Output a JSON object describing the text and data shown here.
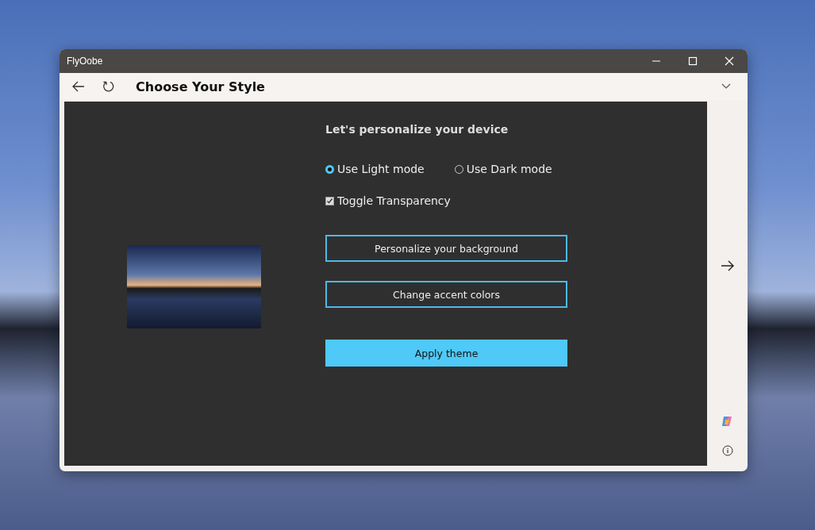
{
  "window": {
    "title": "FlyOobe"
  },
  "header": {
    "title": "Choose Your Style"
  },
  "panel": {
    "heading": "Let's personalize your device",
    "modes": [
      {
        "label": "Use Light mode",
        "selected": true
      },
      {
        "label": "Use Dark mode",
        "selected": false
      }
    ],
    "transparency": {
      "label": "Toggle Transparency",
      "checked": true
    },
    "buttons": [
      {
        "label": "Personalize your background",
        "kind": "outline"
      },
      {
        "label": "Change accent colors",
        "kind": "outline"
      },
      {
        "label": "Apply theme",
        "kind": "primary"
      }
    ]
  }
}
